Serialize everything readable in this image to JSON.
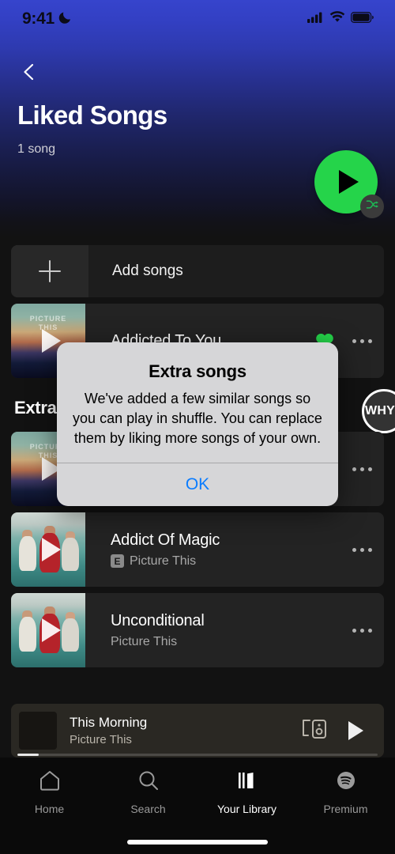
{
  "status_bar": {
    "time": "9:41",
    "dnd_icon": "moon-icon",
    "signal_icon": "cellular-signal-icon",
    "wifi_icon": "wifi-icon",
    "battery_icon": "battery-icon"
  },
  "header": {
    "back_icon": "chevron-left-icon",
    "title": "Liked Songs",
    "subtitle": "1 song",
    "play_icon": "play-icon",
    "shuffle_icon": "shuffle-icon",
    "accent_green": "#25d44a"
  },
  "add_songs": {
    "label": "Add songs",
    "icon": "plus-icon"
  },
  "liked_section": {
    "songs": [
      {
        "title": "Addicted To You",
        "artist": "",
        "explicit": false,
        "liked": true,
        "art": "sunset",
        "art_caption_line1": "PICTURE",
        "art_caption_line2": "THIS",
        "menu_icon": "more-options-icon",
        "heart_icon": "heart-filled-icon"
      }
    ]
  },
  "extra_section": {
    "title": "Extra songs",
    "why_badge": "WHY?",
    "songs": [
      {
        "title": "",
        "artist": "",
        "explicit": false,
        "liked": false,
        "art": "sunset",
        "art_caption_line1": "PICTURE",
        "art_caption_line2": "THIS",
        "menu_icon": "more-options-icon"
      },
      {
        "title": "Addict Of Magic",
        "artist": "Picture This",
        "explicit": true,
        "explicit_label": "E",
        "liked": false,
        "art": "water",
        "menu_icon": "more-options-icon"
      },
      {
        "title": "Unconditional",
        "artist": "Picture This",
        "explicit": false,
        "liked": false,
        "art": "water",
        "menu_icon": "more-options-icon"
      }
    ]
  },
  "now_playing": {
    "title": "This Morning",
    "artist": "Picture This",
    "connect_icon": "connect-to-device-icon",
    "play_icon": "play-icon",
    "progress_percent": 6
  },
  "bottom_nav": {
    "items": [
      {
        "label": "Home",
        "icon": "home-icon",
        "active": false
      },
      {
        "label": "Search",
        "icon": "search-icon",
        "active": false
      },
      {
        "label": "Your Library",
        "icon": "library-icon",
        "active": true
      },
      {
        "label": "Premium",
        "icon": "spotify-logo-icon",
        "active": false
      }
    ]
  },
  "alert": {
    "title": "Extra songs",
    "message": "We've added a few similar songs so you can play in shuffle. You can replace them by liking more songs of your own.",
    "ok_label": "OK",
    "ok_color": "#0a7cff"
  }
}
